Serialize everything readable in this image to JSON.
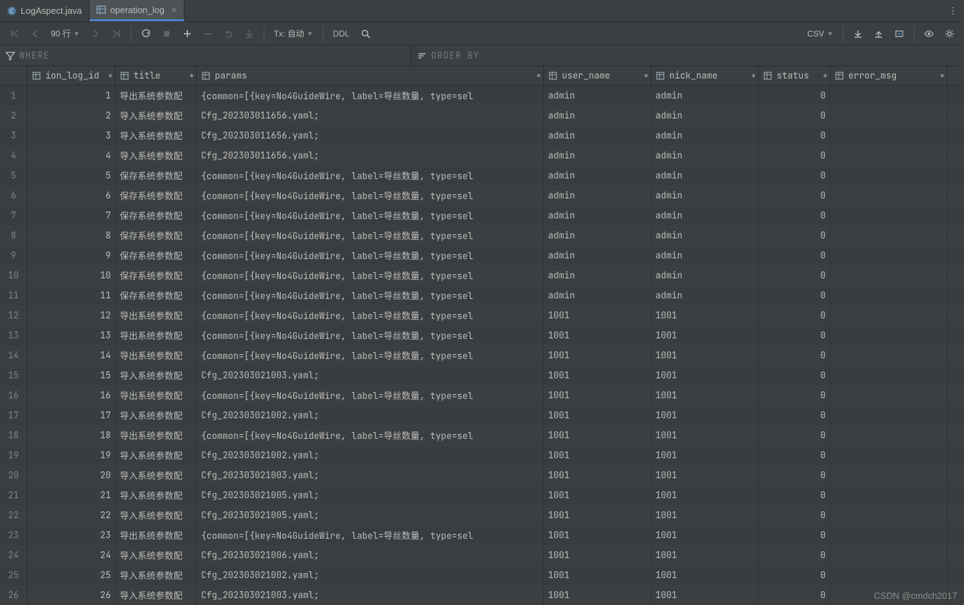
{
  "tabs": [
    {
      "label": "LogAspect.java",
      "icon": "class-icon",
      "active": false,
      "closable": false
    },
    {
      "label": "operation_log",
      "icon": "table-icon",
      "active": true,
      "closable": true
    }
  ],
  "toolbar": {
    "rows_label": "90 行",
    "tx_label": "Tx: 自动",
    "ddl_label": "DDL",
    "export_format": "CSV"
  },
  "filter": {
    "where_placeholder": "WHERE",
    "orderby_placeholder": "ORDER BY"
  },
  "columns": [
    {
      "key": "ion_log_id",
      "label": "ion_log_id",
      "cls": "c-id",
      "align": "num",
      "icon": "col"
    },
    {
      "key": "title",
      "label": "title",
      "cls": "c-title",
      "align": "",
      "icon": "col"
    },
    {
      "key": "params",
      "label": "params",
      "cls": "c-params",
      "align": "",
      "icon": "col"
    },
    {
      "key": "user_name",
      "label": "user_name",
      "cls": "c-user",
      "align": "",
      "icon": "col"
    },
    {
      "key": "nick_name",
      "label": "nick_name",
      "cls": "c-nick",
      "align": "",
      "icon": "col"
    },
    {
      "key": "status",
      "label": "status",
      "cls": "c-status",
      "align": "num",
      "icon": "col"
    },
    {
      "key": "error_msg",
      "label": "error_msg",
      "cls": "c-err",
      "align": "",
      "icon": "col"
    }
  ],
  "rows": [
    {
      "n": 1,
      "ion_log_id": 1,
      "title": "导出系统参数配",
      "params": "{common=[{key=No4GuideWire, label=导丝数量, type=sel",
      "user_name": "admin",
      "nick_name": "admin",
      "status": 0,
      "error_msg": ""
    },
    {
      "n": 2,
      "ion_log_id": 2,
      "title": "导入系统参数配",
      "params": "Cfg_202303011656.yaml;",
      "user_name": "admin",
      "nick_name": "admin",
      "status": 0,
      "error_msg": ""
    },
    {
      "n": 3,
      "ion_log_id": 3,
      "title": "导入系统参数配",
      "params": "Cfg_202303011656.yaml;",
      "user_name": "admin",
      "nick_name": "admin",
      "status": 0,
      "error_msg": ""
    },
    {
      "n": 4,
      "ion_log_id": 4,
      "title": "导入系统参数配",
      "params": "Cfg_202303011656.yaml;",
      "user_name": "admin",
      "nick_name": "admin",
      "status": 0,
      "error_msg": ""
    },
    {
      "n": 5,
      "ion_log_id": 5,
      "title": "保存系统参数配",
      "params": "{common=[{key=No4GuideWire, label=导丝数量, type=sel",
      "user_name": "admin",
      "nick_name": "admin",
      "status": 0,
      "error_msg": ""
    },
    {
      "n": 6,
      "ion_log_id": 6,
      "title": "保存系统参数配",
      "params": "{common=[{key=No4GuideWire, label=导丝数量, type=sel",
      "user_name": "admin",
      "nick_name": "admin",
      "status": 0,
      "error_msg": ""
    },
    {
      "n": 7,
      "ion_log_id": 7,
      "title": "保存系统参数配",
      "params": "{common=[{key=No4GuideWire, label=导丝数量, type=sel",
      "user_name": "admin",
      "nick_name": "admin",
      "status": 0,
      "error_msg": ""
    },
    {
      "n": 8,
      "ion_log_id": 8,
      "title": "保存系统参数配",
      "params": "{common=[{key=No4GuideWire, label=导丝数量, type=sel",
      "user_name": "admin",
      "nick_name": "admin",
      "status": 0,
      "error_msg": ""
    },
    {
      "n": 9,
      "ion_log_id": 9,
      "title": "保存系统参数配",
      "params": "{common=[{key=No4GuideWire, label=导丝数量, type=sel",
      "user_name": "admin",
      "nick_name": "admin",
      "status": 0,
      "error_msg": ""
    },
    {
      "n": 10,
      "ion_log_id": 10,
      "title": "保存系统参数配",
      "params": "{common=[{key=No4GuideWire, label=导丝数量, type=sel",
      "user_name": "admin",
      "nick_name": "admin",
      "status": 0,
      "error_msg": ""
    },
    {
      "n": 11,
      "ion_log_id": 11,
      "title": "保存系统参数配",
      "params": "{common=[{key=No4GuideWire, label=导丝数量, type=sel",
      "user_name": "admin",
      "nick_name": "admin",
      "status": 0,
      "error_msg": ""
    },
    {
      "n": 12,
      "ion_log_id": 12,
      "title": "导出系统参数配",
      "params": "{common=[{key=No4GuideWire, label=导丝数量, type=sel",
      "user_name": "1001",
      "nick_name": "1001",
      "status": 0,
      "error_msg": ""
    },
    {
      "n": 13,
      "ion_log_id": 13,
      "title": "导出系统参数配",
      "params": "{common=[{key=No4GuideWire, label=导丝数量, type=sel",
      "user_name": "1001",
      "nick_name": "1001",
      "status": 0,
      "error_msg": ""
    },
    {
      "n": 14,
      "ion_log_id": 14,
      "title": "导出系统参数配",
      "params": "{common=[{key=No4GuideWire, label=导丝数量, type=sel",
      "user_name": "1001",
      "nick_name": "1001",
      "status": 0,
      "error_msg": ""
    },
    {
      "n": 15,
      "ion_log_id": 15,
      "title": "导入系统参数配",
      "params": "Cfg_202303021003.yaml;",
      "user_name": "1001",
      "nick_name": "1001",
      "status": 0,
      "error_msg": ""
    },
    {
      "n": 16,
      "ion_log_id": 16,
      "title": "导出系统参数配",
      "params": "{common=[{key=No4GuideWire, label=导丝数量, type=sel",
      "user_name": "1001",
      "nick_name": "1001",
      "status": 0,
      "error_msg": ""
    },
    {
      "n": 17,
      "ion_log_id": 17,
      "title": "导入系统参数配",
      "params": "Cfg_202303021002.yaml;",
      "user_name": "1001",
      "nick_name": "1001",
      "status": 0,
      "error_msg": ""
    },
    {
      "n": 18,
      "ion_log_id": 18,
      "title": "导出系统参数配",
      "params": "{common=[{key=No4GuideWire, label=导丝数量, type=sel",
      "user_name": "1001",
      "nick_name": "1001",
      "status": 0,
      "error_msg": ""
    },
    {
      "n": 19,
      "ion_log_id": 19,
      "title": "导入系统参数配",
      "params": "Cfg_202303021002.yaml;",
      "user_name": "1001",
      "nick_name": "1001",
      "status": 0,
      "error_msg": ""
    },
    {
      "n": 20,
      "ion_log_id": 20,
      "title": "导入系统参数配",
      "params": "Cfg_202303021003.yaml;",
      "user_name": "1001",
      "nick_name": "1001",
      "status": 0,
      "error_msg": ""
    },
    {
      "n": 21,
      "ion_log_id": 21,
      "title": "导入系统参数配",
      "params": "Cfg_202303021005.yaml;",
      "user_name": "1001",
      "nick_name": "1001",
      "status": 0,
      "error_msg": ""
    },
    {
      "n": 22,
      "ion_log_id": 22,
      "title": "导入系统参数配",
      "params": "Cfg_202303021005.yaml;",
      "user_name": "1001",
      "nick_name": "1001",
      "status": 0,
      "error_msg": ""
    },
    {
      "n": 23,
      "ion_log_id": 23,
      "title": "导出系统参数配",
      "params": "{common=[{key=No4GuideWire, label=导丝数量, type=sel",
      "user_name": "1001",
      "nick_name": "1001",
      "status": 0,
      "error_msg": ""
    },
    {
      "n": 24,
      "ion_log_id": 24,
      "title": "导入系统参数配",
      "params": "Cfg_202303021006.yaml;",
      "user_name": "1001",
      "nick_name": "1001",
      "status": 0,
      "error_msg": ""
    },
    {
      "n": 25,
      "ion_log_id": 25,
      "title": "导入系统参数配",
      "params": "Cfg_202303021002.yaml;",
      "user_name": "1001",
      "nick_name": "1001",
      "status": 0,
      "error_msg": ""
    },
    {
      "n": 26,
      "ion_log_id": 26,
      "title": "导入系统参数配",
      "params": "Cfg_202303021003.yaml;",
      "user_name": "1001",
      "nick_name": "1001",
      "status": 0,
      "error_msg": ""
    }
  ],
  "watermark": "CSDN @cmdch2017"
}
